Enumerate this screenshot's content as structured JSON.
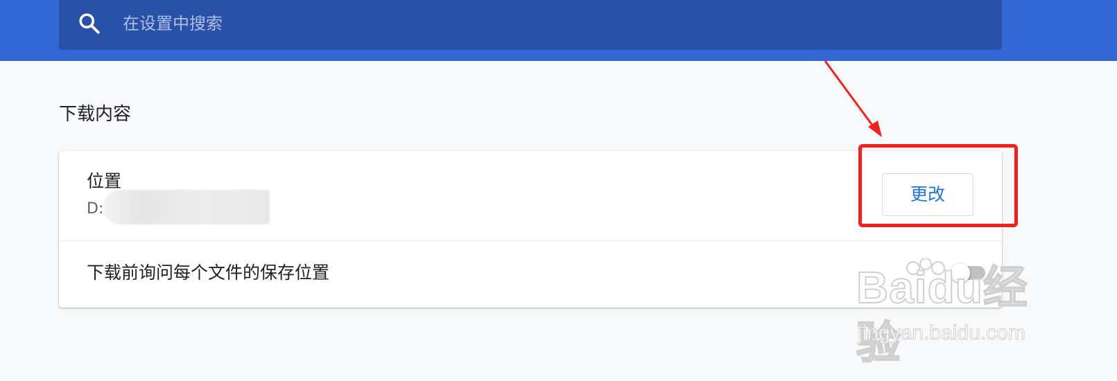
{
  "search": {
    "placeholder": "在设置中搜索",
    "icon": "search-icon"
  },
  "downloads": {
    "section_title": "下载内容",
    "location": {
      "label": "位置",
      "path": "D:"
    },
    "change_button": "更改",
    "ask_each_file": {
      "label": "下载前询问每个文件的保存位置",
      "enabled": false
    }
  },
  "annotation": {
    "highlight_color": "#f5201b"
  },
  "watermark": {
    "brand": "Baidu经验",
    "url": "jingyan.baidu.com"
  },
  "colors": {
    "header_bg": "#3367d6",
    "search_bg": "#2a51a8",
    "page_bg": "#f8f9fa",
    "accent": "#1a73e8"
  }
}
